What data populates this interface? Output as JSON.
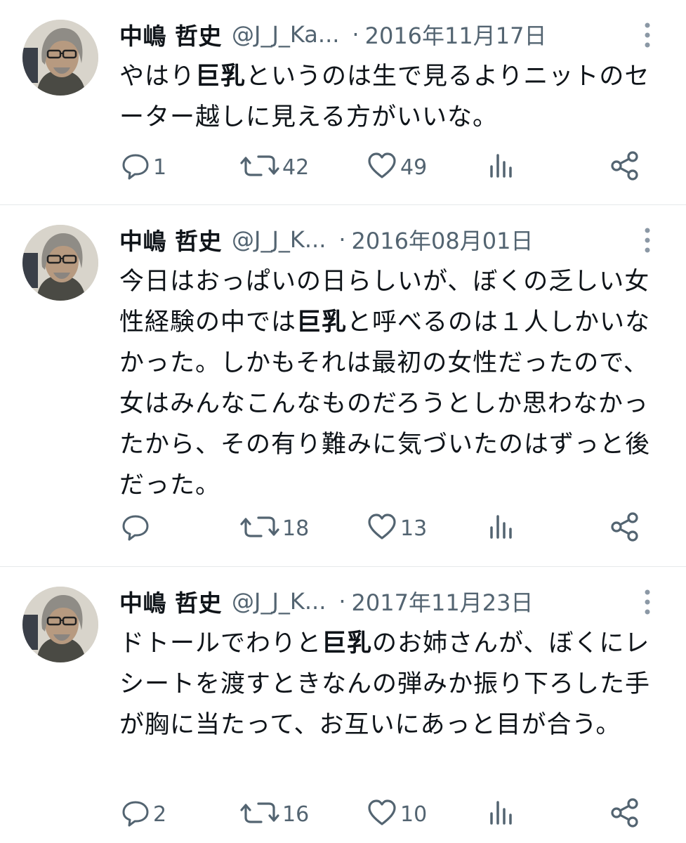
{
  "tweets": [
    {
      "author": {
        "name": "中嶋 哲史",
        "handle": "@J_J_Ka..."
      },
      "separator": "·",
      "date": "2016年11月17日",
      "text_parts": [
        {
          "text": "やはり",
          "bold": false
        },
        {
          "text": "巨乳",
          "bold": true
        },
        {
          "text": "というのは生で見るよりニットのセーター越しに見える方がいいな。",
          "bold": false
        }
      ],
      "stats": {
        "replies": "1",
        "retweets": "42",
        "likes": "49"
      }
    },
    {
      "author": {
        "name": "中嶋 哲史",
        "handle": "@J_J_K..."
      },
      "separator": "·",
      "date": "2016年08月01日",
      "text_parts": [
        {
          "text": "今日はおっぱいの日らしいが、ぼくの乏しい女性経験の中では",
          "bold": false
        },
        {
          "text": "巨乳",
          "bold": true
        },
        {
          "text": "と呼べるのは１人しかいなかった。しかもそれは最初の女性だったので、女はみんなこんなものだろうとしか思わなかったから、その有り難みに気づいたのはずっと後だった。",
          "bold": false
        }
      ],
      "stats": {
        "replies": "",
        "retweets": "18",
        "likes": "13"
      }
    },
    {
      "author": {
        "name": "中嶋 哲史",
        "handle": "@J_J_K..."
      },
      "separator": "·",
      "date": "2017年11月23日",
      "text_parts": [
        {
          "text": "ドトールでわりと",
          "bold": false
        },
        {
          "text": "巨乳",
          "bold": true
        },
        {
          "text": "のお姉さんが、ぼくにレシートを渡すときなんの弾みか振り下ろした手が胸に当たって、お互いにあっと目が合う。",
          "bold": false
        }
      ],
      "stats": {
        "replies": "2",
        "retweets": "16",
        "likes": "10"
      }
    }
  ],
  "icons": {
    "reply": "speech-bubble-icon",
    "retweet": "retweet-arrows-icon",
    "like": "heart-icon",
    "views": "bar-chart-icon",
    "share": "share-nodes-icon",
    "more": "vertical-dots-icon"
  },
  "colors": {
    "text": "#0f1419",
    "secondary": "#536471",
    "divider": "#e6e9eb",
    "icon": "#536471"
  }
}
